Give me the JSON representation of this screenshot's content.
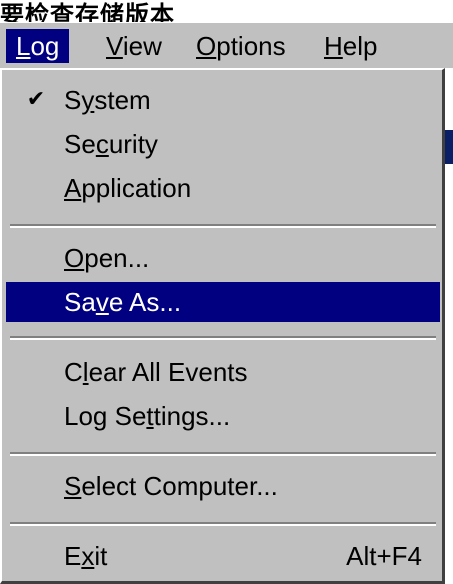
{
  "window_fragment_title": "要检查存储版本",
  "menubar": {
    "items": [
      {
        "pre": "",
        "key": "L",
        "post": "og"
      },
      {
        "pre": "",
        "key": "V",
        "post": "iew"
      },
      {
        "pre": "",
        "key": "O",
        "post": "ptions"
      },
      {
        "pre": "",
        "key": "H",
        "post": "elp"
      }
    ],
    "active_index": 0
  },
  "log_menu": {
    "items": [
      {
        "pre": "S",
        "key": "y",
        "post": "stem",
        "checked": true,
        "check_icon": "checkmark-icon"
      },
      {
        "pre": "Se",
        "key": "c",
        "post": "urity"
      },
      {
        "pre": "",
        "key": "A",
        "post": "pplication"
      },
      {
        "pre": "",
        "key": "O",
        "post": "pen..."
      },
      {
        "pre": "Sa",
        "key": "v",
        "post": "e As...",
        "selected": true
      },
      {
        "pre": "C",
        "key": "l",
        "post": "ear All Events"
      },
      {
        "pre": "Log Se",
        "key": "t",
        "post": "tings..."
      },
      {
        "pre": "",
        "key": "S",
        "post": "elect Computer..."
      },
      {
        "pre": "E",
        "key": "x",
        "post": "it",
        "accelerator": "Alt+F4"
      }
    ]
  },
  "colors": {
    "menu_face": "#c0c0c0",
    "selection": "#000080",
    "selection_text": "#ffffff"
  }
}
